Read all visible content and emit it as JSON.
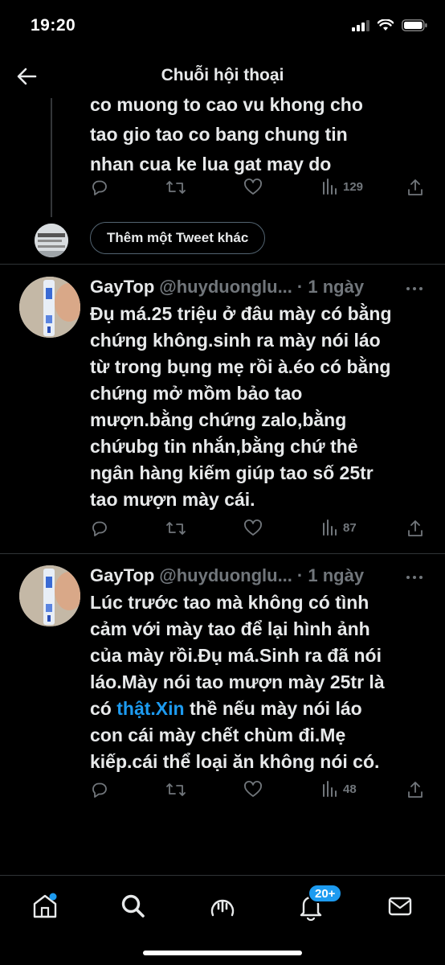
{
  "status": {
    "time": "19:20"
  },
  "header": {
    "title": "Chuỗi hội thoại"
  },
  "previous_tweet": {
    "text_lines": [
      "co muong to cao  vu khong cho",
      "tao gio tao co bang chung tin",
      "nhan cua ke lua gat may do"
    ],
    "views": "129"
  },
  "more_tweets_button": "Thêm một Tweet khác",
  "tweets": [
    {
      "name": "GayTop",
      "handle": "@huyduonglu...",
      "time": "· 1 ngày",
      "lines": [
        "Đụ má.25 triệu ở đâu mày có bằng",
        "chứng không.sinh ra mày nói láo",
        "từ trong bụng mẹ rồi à.éo có bằng",
        "chứng mở mồm bảo tao",
        "mượn.bằng  chứng zalo,bằng",
        "chứubg tin nhắn,bằng chứ thẻ",
        "ngân hàng kiếm giúp tao số 25tr",
        "tao mượn mày cái."
      ],
      "views": "87"
    },
    {
      "name": "GayTop",
      "handle": "@huyduonglu...",
      "time": "· 1 ngày",
      "lines": [
        "Lúc trước tao mà không có tình",
        "cảm với mày tao để lại hình ảnh",
        "của mày rồi.Đụ má.Sinh ra đã nói",
        "láo.Mày nói tao mượn mày 25tr là"
      ],
      "line5_pre": "có ",
      "line5_link": "thật.Xin",
      "line5_post": " thề nếu mày nói láo",
      "lines_after": [
        "con cái mày chết chùm đi.Mẹ",
        "kiếp.cái thể loại ăn không nói có."
      ],
      "views": "48"
    }
  ],
  "nav": {
    "notifications_badge": "20+"
  },
  "icons": [
    "back-arrow-icon",
    "reply-icon",
    "retweet-icon",
    "like-icon",
    "views-icon",
    "share-icon",
    "more-icon",
    "home-icon",
    "search-icon",
    "spaces-icon",
    "bell-icon",
    "mail-icon"
  ]
}
